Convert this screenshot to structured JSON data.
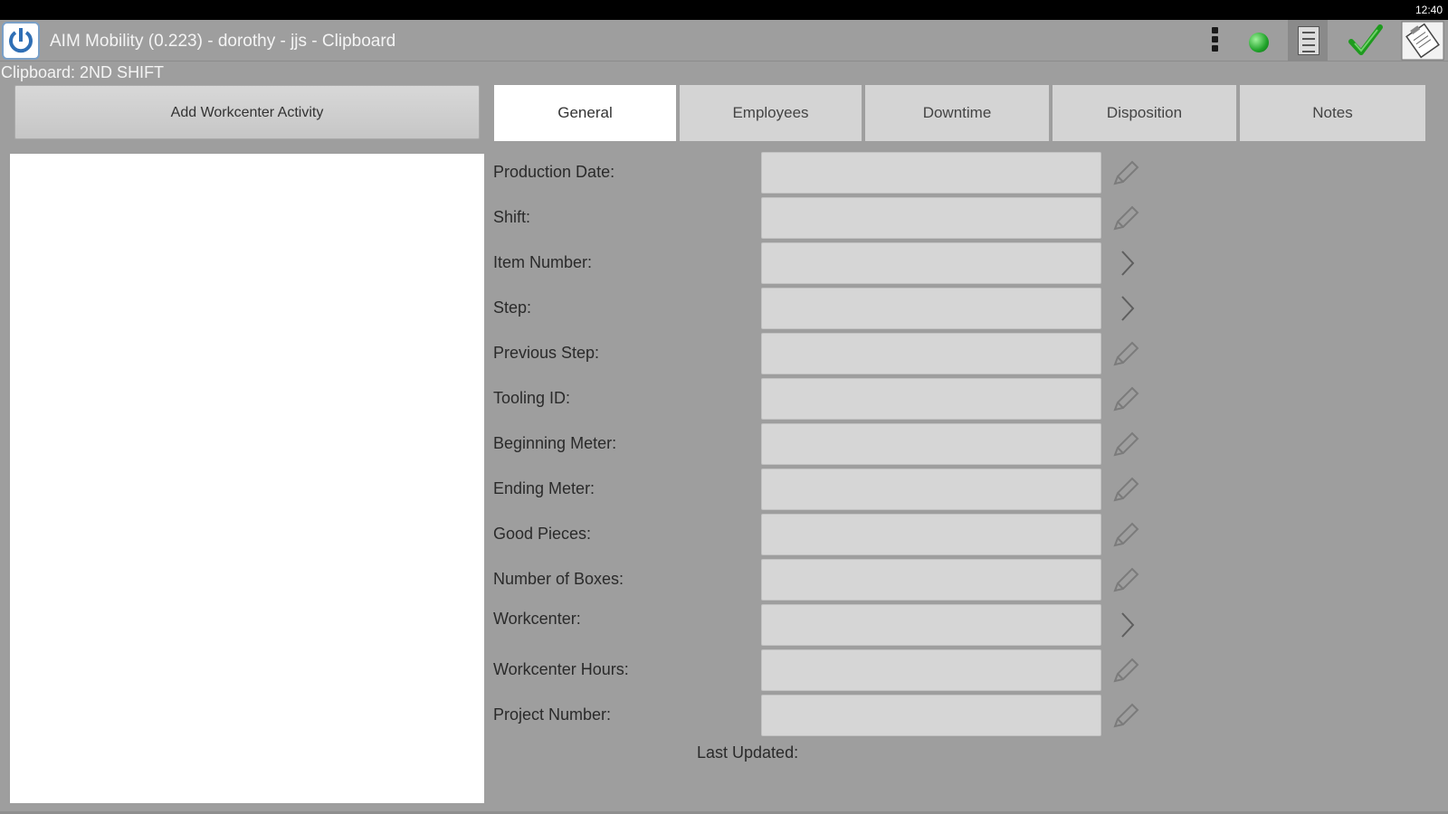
{
  "status_bar": {
    "clock": "12:40"
  },
  "action_bar": {
    "title": "AIM Mobility (0.223) - dorothy - jjs - Clipboard",
    "icons": [
      "app-logo-icon",
      "overflow-menu-icon",
      "sync-status-icon",
      "document-icon",
      "checkmark-icon",
      "clipboard-icon"
    ],
    "sync_color": "#20a32a",
    "check_color": "#1e9b1e"
  },
  "subtitle": "Clipboard: 2ND SHIFT",
  "add_button": {
    "label": "Add Workcenter Activity"
  },
  "tabs": [
    {
      "label": "General",
      "active": true
    },
    {
      "label": "Employees",
      "active": false
    },
    {
      "label": "Downtime",
      "active": false
    },
    {
      "label": "Disposition",
      "active": false
    },
    {
      "label": "Notes",
      "active": false
    }
  ],
  "form": {
    "fields": [
      {
        "label": "Production Date:",
        "value": "",
        "action": "pencil-icon"
      },
      {
        "label": "Shift:",
        "value": "",
        "action": "pencil-icon"
      },
      {
        "label": "Item Number:",
        "value": "",
        "action": "chevron-right-icon"
      },
      {
        "label": "Step:",
        "value": "",
        "action": "chevron-right-icon"
      },
      {
        "label": "Previous Step:",
        "value": "",
        "action": "pencil-icon"
      },
      {
        "label": "Tooling ID:",
        "value": "",
        "action": "pencil-icon"
      },
      {
        "label": "Beginning Meter:",
        "value": "",
        "action": "pencil-icon"
      },
      {
        "label": "Ending Meter:",
        "value": "",
        "action": "pencil-icon"
      },
      {
        "label": "Good Pieces:",
        "value": "",
        "action": "pencil-icon"
      },
      {
        "label": "Number of Boxes:",
        "value": "",
        "action": "pencil-icon"
      },
      {
        "label": "Workcenter:",
        "value": "",
        "action": "chevron-right-icon"
      },
      {
        "label": "Workcenter Hours:",
        "value": "",
        "action": "pencil-icon"
      },
      {
        "label": "Project Number:",
        "value": "",
        "action": "pencil-icon"
      }
    ],
    "last_updated_label": "Last Updated:"
  }
}
